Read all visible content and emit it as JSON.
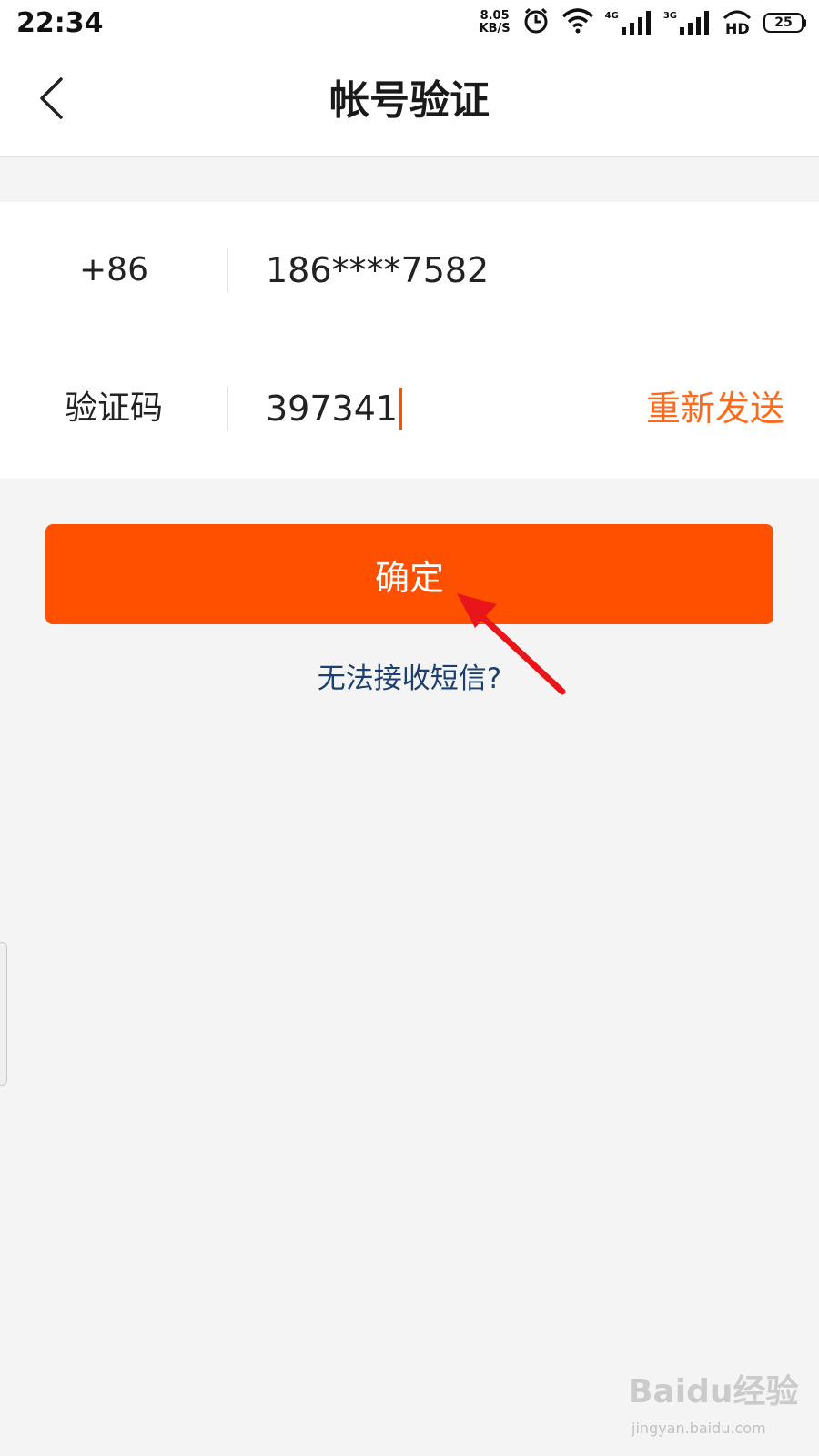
{
  "status_bar": {
    "time": "22:34",
    "net_speed_value": "8.05",
    "net_speed_unit": "KB/S",
    "signal_1_tag": "4G",
    "signal_2_tag": "3G",
    "hd_label": "HD",
    "battery_level": "25",
    "icons": [
      "alarm-icon",
      "wifi-icon",
      "signal-4g-icon",
      "signal-3g-icon",
      "hd-icon",
      "battery-icon"
    ]
  },
  "nav": {
    "back_icon": "chevron-left-icon",
    "title": "帐号验证"
  },
  "form": {
    "phone_row": {
      "country_code": "+86",
      "phone_number": "186****7582"
    },
    "code_row": {
      "label": "验证码",
      "code_value": "397341",
      "resend_label": "重新发送"
    }
  },
  "confirm_button_label": "确定",
  "sms_help_link": "无法接收短信?",
  "colors": {
    "accent": "#ff5000",
    "resend": "#ff6a1a",
    "link": "#1c3f6e",
    "annotation_arrow": "#e8151b"
  },
  "watermark": {
    "main": "Baidu经验",
    "sub": "jingyan.baidu.com"
  }
}
